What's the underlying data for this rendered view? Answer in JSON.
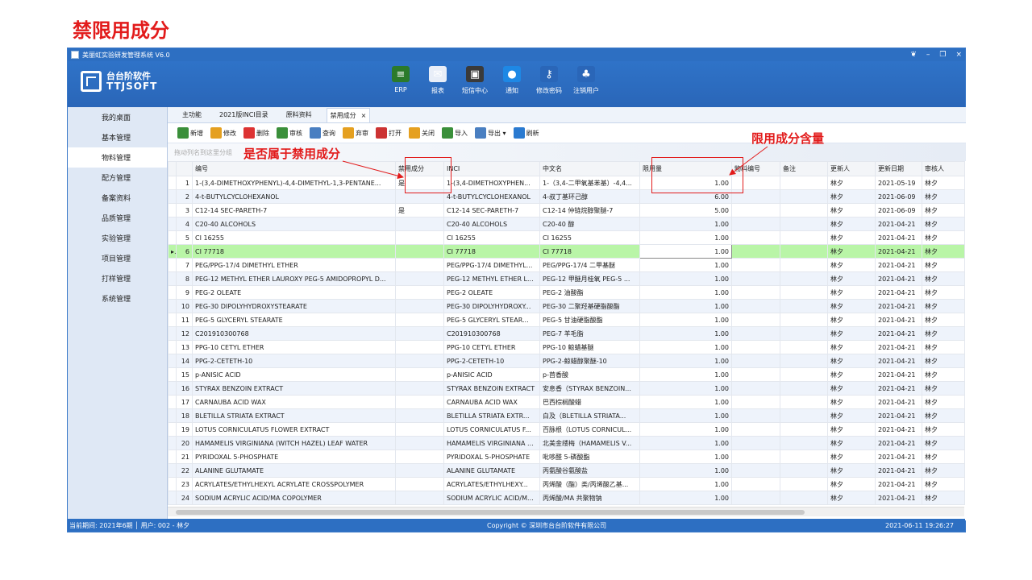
{
  "slide_title": "禁限用成分",
  "window": {
    "title": "美丽虹实验研发管理系统 V6.0",
    "controls": [
      "❦",
      "–",
      "❐",
      "×"
    ]
  },
  "logo": {
    "cn": "台台阶软件",
    "en": "TTJSOFT"
  },
  "top_toolbar": [
    {
      "label": "ERP",
      "icon": "erp-icon",
      "color": "#2b7a2b",
      "glyph": "≡"
    },
    {
      "label": "报表",
      "icon": "report-icon",
      "color": "#e8eef8",
      "glyph": "✉"
    },
    {
      "label": "短信中心",
      "icon": "sms-icon",
      "color": "#3a3a3a",
      "glyph": "▣"
    },
    {
      "label": "通知",
      "icon": "notify-icon",
      "color": "#1e88e5",
      "glyph": "●"
    },
    {
      "label": "修改密码",
      "icon": "key-icon",
      "color": "#2a66b8",
      "glyph": "⚷"
    },
    {
      "label": "注销用户",
      "icon": "users-icon",
      "color": "#2a66b8",
      "glyph": "♣"
    }
  ],
  "sidebar": {
    "items": [
      {
        "label": "我的桌面"
      },
      {
        "label": "基本管理"
      },
      {
        "label": "物料管理"
      },
      {
        "label": "配方管理"
      },
      {
        "label": "备案资料"
      },
      {
        "label": "品质管理"
      },
      {
        "label": "实验管理"
      },
      {
        "label": "项目管理"
      },
      {
        "label": "打样管理"
      },
      {
        "label": "系统管理"
      }
    ]
  },
  "tabs": [
    "主功能",
    "2021版INCI目录",
    "原料资料",
    "禁用成分"
  ],
  "tab_close": "×",
  "actions": [
    {
      "label": "新增",
      "color": "#3a8f3a"
    },
    {
      "label": "修改",
      "color": "#e5a020"
    },
    {
      "label": "删除",
      "color": "#d33"
    },
    {
      "label": "审核",
      "color": "#3a8f3a"
    },
    {
      "label": "查询",
      "color": "#4a7fc1"
    },
    {
      "label": "弃审",
      "color": "#e5a020"
    },
    {
      "label": "打开",
      "color": "#c33"
    },
    {
      "label": "关闭",
      "color": "#e5a020"
    },
    {
      "label": "导入",
      "color": "#3a8f3a"
    },
    {
      "label": "导出 ▾",
      "color": "#4a7fc1"
    },
    {
      "label": "刷新",
      "color": "#2a7ad0"
    }
  ],
  "group_hint": "拖动列名到这里分组",
  "columns": [
    "",
    "",
    "编号",
    "禁用成分",
    "INCI",
    "中文名",
    "限用量",
    "物料编号",
    "备注",
    "更新人",
    "更新日期",
    "审核人"
  ],
  "rows": [
    [
      "1",
      "1-(3,4-DIMETHOXYPHENYL)-4,4-DIMETHYL-1,3-PENTANE...",
      "是",
      "1-(3,4-DIMETHOXYPHEN...",
      "1-（3,4-二甲氧基苯基）-4,4...",
      "1.00",
      "",
      "",
      "林夕",
      "2021-05-19",
      "林夕"
    ],
    [
      "2",
      "4-t-BUTYLCYCLOHEXANOL",
      "",
      "4-t-BUTYLCYCLOHEXANOL",
      "4-叔丁基环己醇",
      "6.00",
      "",
      "",
      "林夕",
      "2021-06-09",
      "林夕"
    ],
    [
      "3",
      "C12-14 SEC-PARETH-7",
      "是",
      "C12-14 SEC-PARETH-7",
      "C12-14 仲链烷醇聚醚-7",
      "5.00",
      "",
      "",
      "林夕",
      "2021-06-09",
      "林夕"
    ],
    [
      "4",
      "C20-40 ALCOHOLS",
      "",
      "C20-40 ALCOHOLS",
      "C20-40 醇",
      "1.00",
      "",
      "",
      "林夕",
      "2021-04-21",
      "林夕"
    ],
    [
      "5",
      "CI 16255",
      "",
      "CI 16255",
      "CI 16255",
      "1.00",
      "",
      "",
      "林夕",
      "2021-04-21",
      "林夕"
    ],
    [
      "6",
      "CI 77718",
      "",
      "CI 77718",
      "CI 77718",
      "1.00",
      "",
      "",
      "林夕",
      "2021-04-21",
      "林夕"
    ],
    [
      "7",
      "PEG/PPG-17/4 DIMETHYL ETHER",
      "",
      "PEG/PPG-17/4 DIMETHYL...",
      "PEG/PPG-17/4 二甲基醚",
      "1.00",
      "",
      "",
      "林夕",
      "2021-04-21",
      "林夕"
    ],
    [
      "8",
      "PEG-12 METHYL ETHER LAUROXY PEG-5 AMIDOPROPYL D...",
      "",
      "PEG-12 METHYL ETHER L...",
      "PEG-12 甲醚月桂氧 PEG-5 ...",
      "1.00",
      "",
      "",
      "林夕",
      "2021-04-21",
      "林夕"
    ],
    [
      "9",
      "PEG-2 OLEATE",
      "",
      "PEG-2 OLEATE",
      "PEG-2 油酸酯",
      "1.00",
      "",
      "",
      "林夕",
      "2021-04-21",
      "林夕"
    ],
    [
      "10",
      "PEG-30 DIPOLYHYDROXYSTEARATE",
      "",
      "PEG-30 DIPOLYHYDROXY...",
      "PEG-30 二聚羟基硬脂酸酯",
      "1.00",
      "",
      "",
      "林夕",
      "2021-04-21",
      "林夕"
    ],
    [
      "11",
      "PEG-5 GLYCERYL STEARATE",
      "",
      "PEG-5 GLYCERYL STEAR...",
      "PEG-5 甘油硬脂酸酯",
      "1.00",
      "",
      "",
      "林夕",
      "2021-04-21",
      "林夕"
    ],
    [
      "12",
      "C201910300768",
      "",
      "C201910300768",
      "PEG-7 羊毛脂",
      "1.00",
      "",
      "",
      "林夕",
      "2021-04-21",
      "林夕"
    ],
    [
      "13",
      "PPG-10 CETYL ETHER",
      "",
      "PPG-10 CETYL ETHER",
      "PPG-10 鲸蜡基醚",
      "1.00",
      "",
      "",
      "林夕",
      "2021-04-21",
      "林夕"
    ],
    [
      "14",
      "PPG-2-CETETH-10",
      "",
      "PPG-2-CETETH-10",
      "PPG-2-鲸蜡醇聚醚-10",
      "1.00",
      "",
      "",
      "林夕",
      "2021-04-21",
      "林夕"
    ],
    [
      "15",
      "p-ANISIC ACID",
      "",
      "p-ANISIC ACID",
      "p-茴香酸",
      "1.00",
      "",
      "",
      "林夕",
      "2021-04-21",
      "林夕"
    ],
    [
      "16",
      "STYRAX BENZOIN EXTRACT",
      "",
      "STYRAX BENZOIN EXTRACT",
      "安息香（STYRAX BENZOIN...",
      "1.00",
      "",
      "",
      "林夕",
      "2021-04-21",
      "林夕"
    ],
    [
      "17",
      "CARNAUBA ACID WAX",
      "",
      "CARNAUBA ACID WAX",
      "巴西棕榈酸蜡",
      "1.00",
      "",
      "",
      "林夕",
      "2021-04-21",
      "林夕"
    ],
    [
      "18",
      "BLETILLA STRIATA EXTRACT",
      "",
      "BLETILLA STRIATA EXTR...",
      "白及（BLETILLA STRIATA...",
      "1.00",
      "",
      "",
      "林夕",
      "2021-04-21",
      "林夕"
    ],
    [
      "19",
      "LOTUS CORNICULATUS FLOWER EXTRACT",
      "",
      "LOTUS CORNICULATUS F...",
      "百脉根（LOTUS CORNICUL...",
      "1.00",
      "",
      "",
      "林夕",
      "2021-04-21",
      "林夕"
    ],
    [
      "20",
      "HAMAMELIS VIRGINIANA (WITCH HAZEL) LEAF WATER",
      "",
      "HAMAMELIS VIRGINIANA ...",
      "北美金缕梅（HAMAMELIS V...",
      "1.00",
      "",
      "",
      "林夕",
      "2021-04-21",
      "林夕"
    ],
    [
      "21",
      "PYRIDOXAL 5-PHOSPHATE",
      "",
      "PYRIDOXAL 5-PHOSPHATE",
      "吡哆醛 5-磷酸酯",
      "1.00",
      "",
      "",
      "林夕",
      "2021-04-21",
      "林夕"
    ],
    [
      "22",
      "ALANINE GLUTAMATE",
      "",
      "ALANINE GLUTAMATE",
      "丙氨酸谷氨酸盐",
      "1.00",
      "",
      "",
      "林夕",
      "2021-04-21",
      "林夕"
    ],
    [
      "23",
      "ACRYLATES/ETHYLHEXYL ACRYLATE CROSSPOLYMER",
      "",
      "ACRYLATES/ETHYLHEXY...",
      "丙烯酸（酯）类/丙烯酸乙基...",
      "1.00",
      "",
      "",
      "林夕",
      "2021-04-21",
      "林夕"
    ],
    [
      "24",
      "SODIUM ACRYLIC ACID/MA COPOLYMER",
      "",
      "SODIUM ACRYLIC ACID/M...",
      "丙烯酸/MA 共聚物钠",
      "1.00",
      "",
      "",
      "林夕",
      "2021-04-21",
      "林夕"
    ]
  ],
  "selected_row": 6,
  "selected_marker": "▸",
  "status": {
    "period": "当前期间: 2021年6期 │ 用户: 002 - 林夕",
    "copyright": "Copyright © 深圳市台台阶软件有限公司",
    "time": "2021-06-11 19:26:27"
  },
  "annotations": {
    "banned_flag": "是否属于禁用成分",
    "limit_amount": "限用成分含量"
  },
  "colors": {
    "accent": "#e21b1b",
    "titlebar": "#2d6fc2",
    "selected_row": "#b9f5a7"
  }
}
